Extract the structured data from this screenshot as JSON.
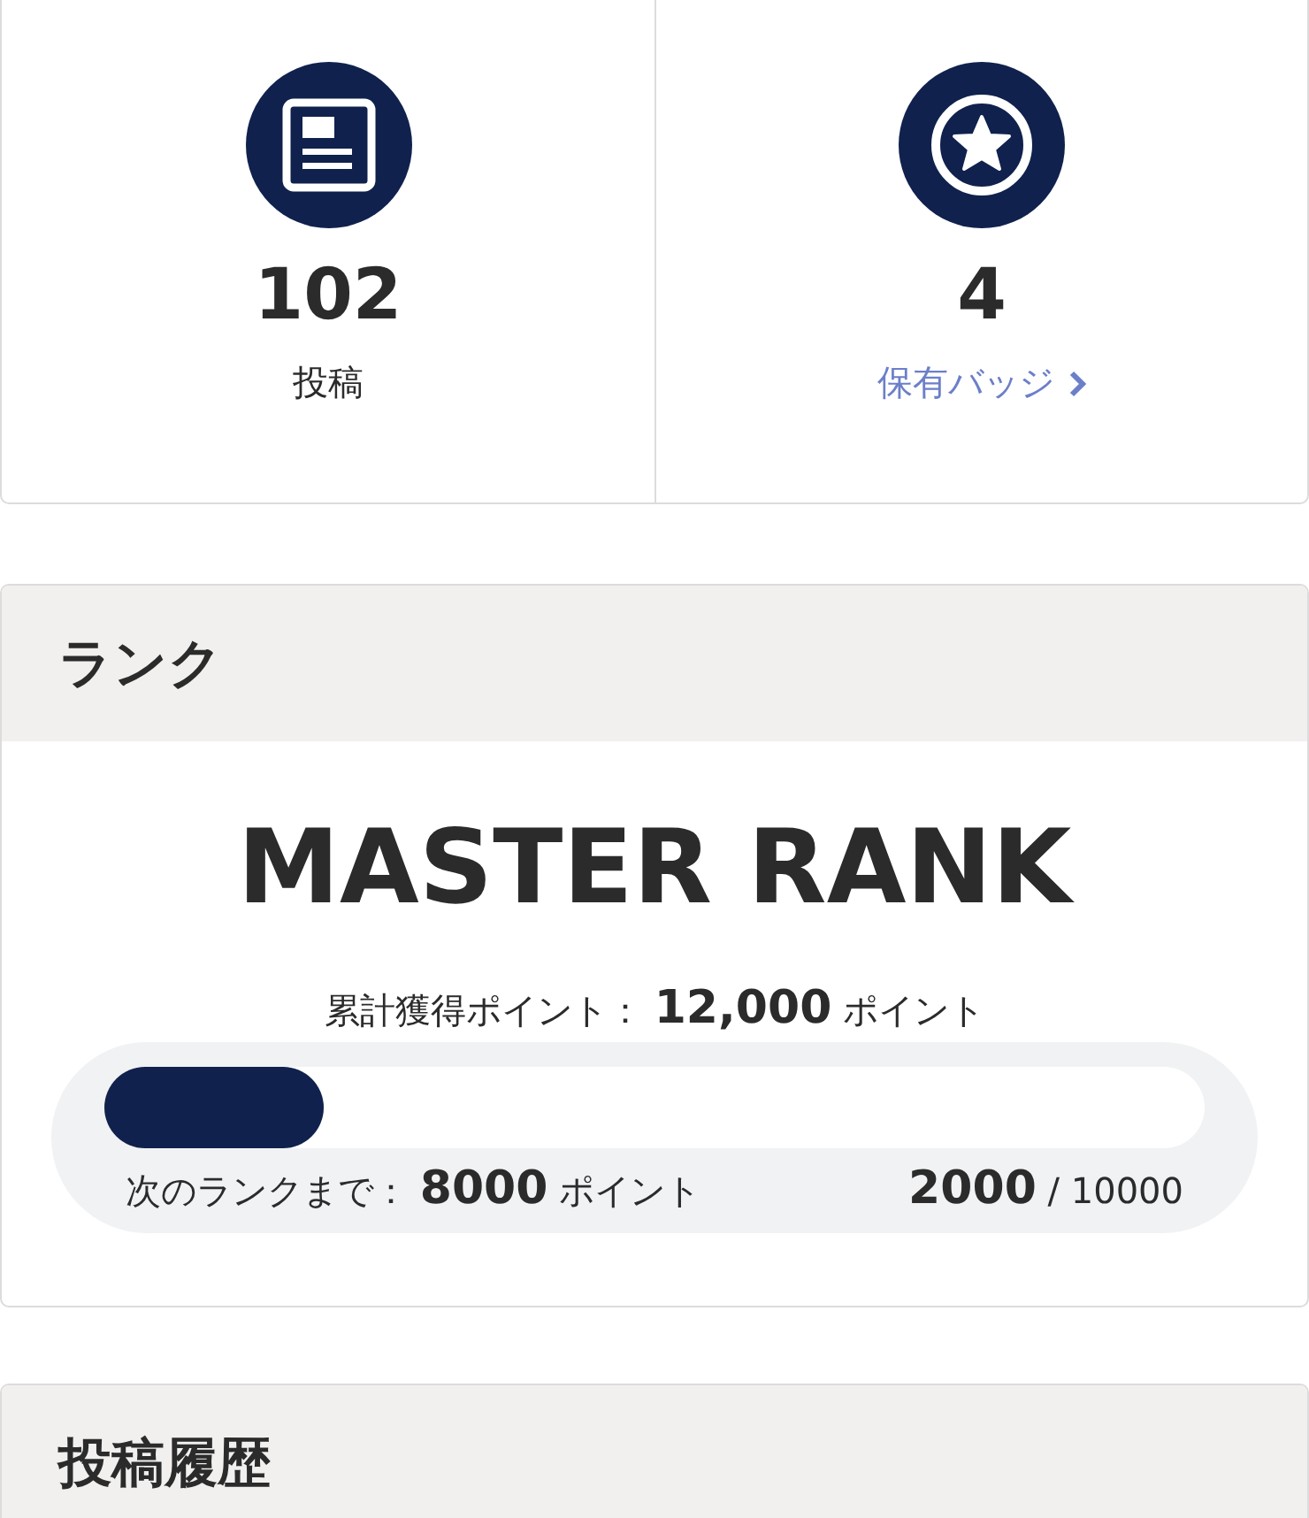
{
  "stats": [
    {
      "kind": "posts",
      "value": "102",
      "label": "投稿",
      "link": false
    },
    {
      "kind": "badges",
      "value": "4",
      "label": "保有バッジ",
      "link": true
    }
  ],
  "rank": {
    "title": "ランク",
    "rank_name": "MASTER RANK",
    "total": "累計獲得ポイント： **12,000** ポイント",
    "level": 0.2,
    "next": "次のランクまで： **8000** ポイント",
    "progress": "**2000** / 10000"
  },
  "history": {
    "title": "投稿履歴"
  }
}
